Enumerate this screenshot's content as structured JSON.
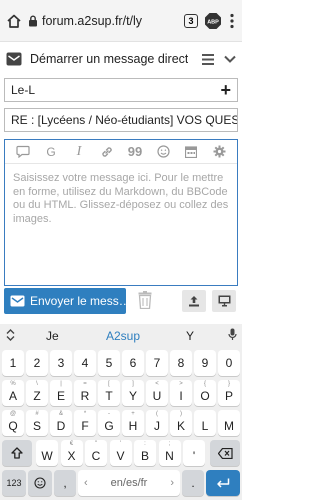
{
  "browser": {
    "url": "forum.a2sup.fr/t/ly",
    "tab_count": "3",
    "abp_label": "ABP"
  },
  "composer": {
    "title": "Démarrer un message direct",
    "recipient": "Le-L",
    "subject": "RE : [Lycéens / Néo-étudiants] VOS QUESTIC",
    "placeholder": "Saisissez votre message ici. Pour le mettre en forme, utilisez du Markdown, du BBCode ou du HTML. Glissez-déposez ou collez des images.",
    "toolbar_g": "G",
    "toolbar_i": "I",
    "toolbar_quote": "99",
    "send_label": "Envoyer le mess…"
  },
  "keyboard": {
    "suggestions": [
      "Je",
      "A2sup",
      "Y"
    ],
    "accent_color": "#2f7fbf",
    "row1": [
      "1",
      "2",
      "3",
      "4",
      "5",
      "6",
      "7",
      "8",
      "9",
      "0"
    ],
    "row2": [
      {
        "sub": "%",
        "main": "A"
      },
      {
        "sub": "\\",
        "main": "Z"
      },
      {
        "sub": "|",
        "main": "E"
      },
      {
        "sub": "=",
        "main": "R"
      },
      {
        "sub": "[",
        "main": "T"
      },
      {
        "sub": "]",
        "main": "Y"
      },
      {
        "sub": "<",
        "main": "U"
      },
      {
        "sub": ">",
        "main": "I"
      },
      {
        "sub": "{",
        "main": "O"
      },
      {
        "sub": "}",
        "main": "P"
      }
    ],
    "row3": [
      {
        "sub": "@",
        "main": "Q"
      },
      {
        "sub": "#",
        "main": "S"
      },
      {
        "sub": "&",
        "main": "D"
      },
      {
        "sub": "*",
        "main": "F"
      },
      {
        "sub": "-",
        "main": "G"
      },
      {
        "sub": "+",
        "main": "H"
      },
      {
        "sub": "(",
        "main": "J"
      },
      {
        "sub": ")",
        "main": "K"
      },
      {
        "sub": "",
        "main": "L"
      },
      {
        "sub": "",
        "main": "M"
      }
    ],
    "row4": [
      {
        "sub": "",
        "main": "W"
      },
      {
        "sub": "€",
        "main": "X"
      },
      {
        "sub": "\"",
        "main": "C"
      },
      {
        "sub": "'",
        "main": "V"
      },
      {
        "sub": ":",
        "main": "B"
      },
      {
        "sub": ";",
        "main": "N"
      },
      {
        "sub": "",
        "main": "'"
      }
    ],
    "numbers_key": "123",
    "comma_key": ",",
    "space_label": "en/es/fr",
    "period_key": "."
  }
}
